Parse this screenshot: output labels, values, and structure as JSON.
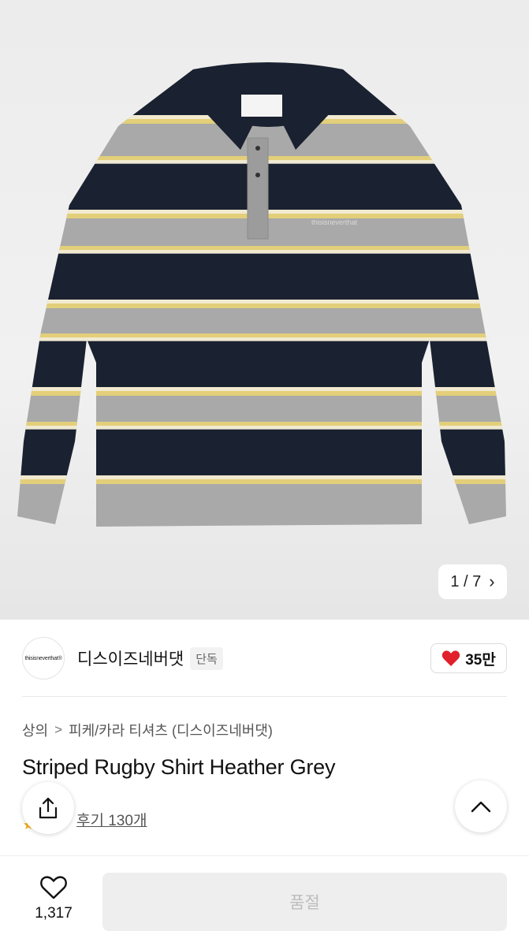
{
  "gallery": {
    "current_page": "1",
    "total_pages": "7",
    "counter_text": "1 / 7",
    "next_icon": "chevron-right-icon",
    "colors": {
      "navy": "#1a2130",
      "grey": "#a9a9a9",
      "yellow": "#e3cf7a",
      "cream": "#f1ead0"
    },
    "garment_logo": "thisisneverthat"
  },
  "brand": {
    "logo_text": "thisisneverthat®",
    "name": "디스이즈네버댓",
    "badge": "단독",
    "likes": "35만",
    "like_icon": "heart-icon",
    "like_color": "#e0202b"
  },
  "breadcrumb": {
    "items": [
      "상의",
      "피케/카라 티셔츠 (디스이즈네버댓)"
    ],
    "separator": ">"
  },
  "product": {
    "title": "Striped Rugby Shirt Heather Grey",
    "reviews": "후기 130개"
  },
  "actions": {
    "share_icon": "share-icon",
    "scroll_top_icon": "chevron-up-icon"
  },
  "bottom_bar": {
    "wish_icon": "heart-outline-icon",
    "wish_count": "1,317",
    "purchase_label": "품절"
  }
}
